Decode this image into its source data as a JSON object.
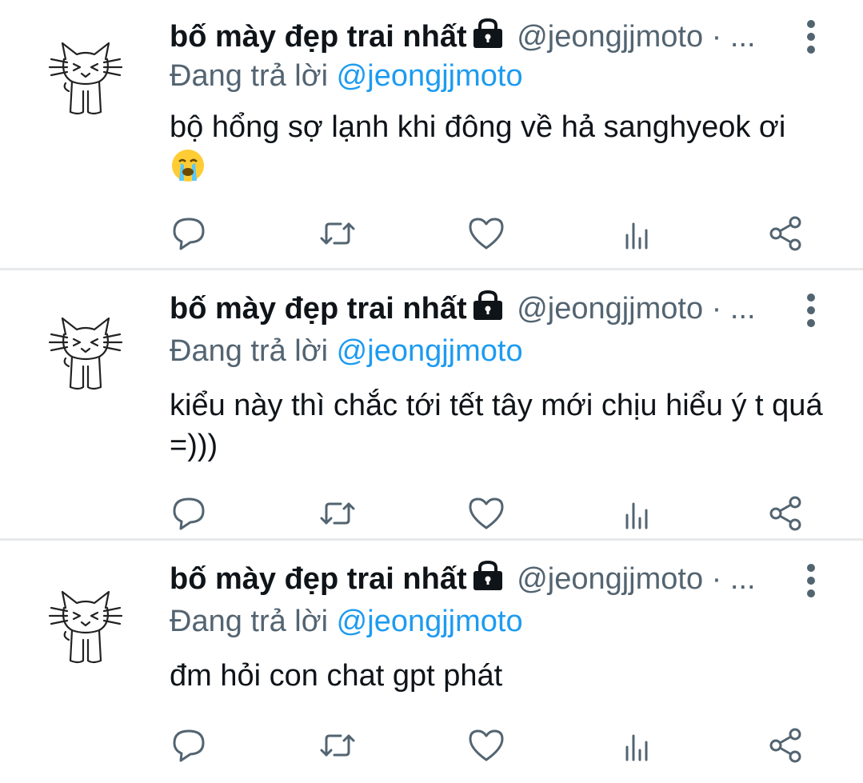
{
  "tweets": [
    {
      "display_name": "bố mày đẹp trai nhất",
      "handle": "@jeongjjmoto",
      "separator": "·",
      "truncation": "...",
      "reply_prefix": "Đang trả lời",
      "reply_mention": "@jeongjjmoto",
      "text": "bộ hổng sợ lạnh khi đông về hả sanghyeok ơi",
      "emoji": "loudly-crying-face"
    },
    {
      "display_name": "bố mày đẹp trai nhất",
      "handle": "@jeongjjmoto",
      "separator": "·",
      "truncation": "...",
      "reply_prefix": "Đang trả lời",
      "reply_mention": "@jeongjjmoto",
      "text": "kiểu này thì chắc tới tết tây mới chịu hiểu ý t quá =)))",
      "emoji": ""
    },
    {
      "display_name": "bố mày đẹp trai nhất",
      "handle": "@jeongjjmoto",
      "separator": "·",
      "truncation": "...",
      "reply_prefix": "Đang trả lời",
      "reply_mention": "@jeongjjmoto",
      "text": "đm hỏi con chat gpt phát",
      "emoji": ""
    }
  ],
  "icons": {
    "lock": "lock-icon",
    "more": "more-vertical-icon",
    "reply": "reply-icon",
    "retweet": "retweet-icon",
    "like": "heart-icon",
    "views": "views-icon",
    "share": "share-icon"
  },
  "colors": {
    "text": "#0f1419",
    "secondary": "#536471",
    "mention": "#1d9bf0",
    "divider": "#e7e9eb"
  }
}
